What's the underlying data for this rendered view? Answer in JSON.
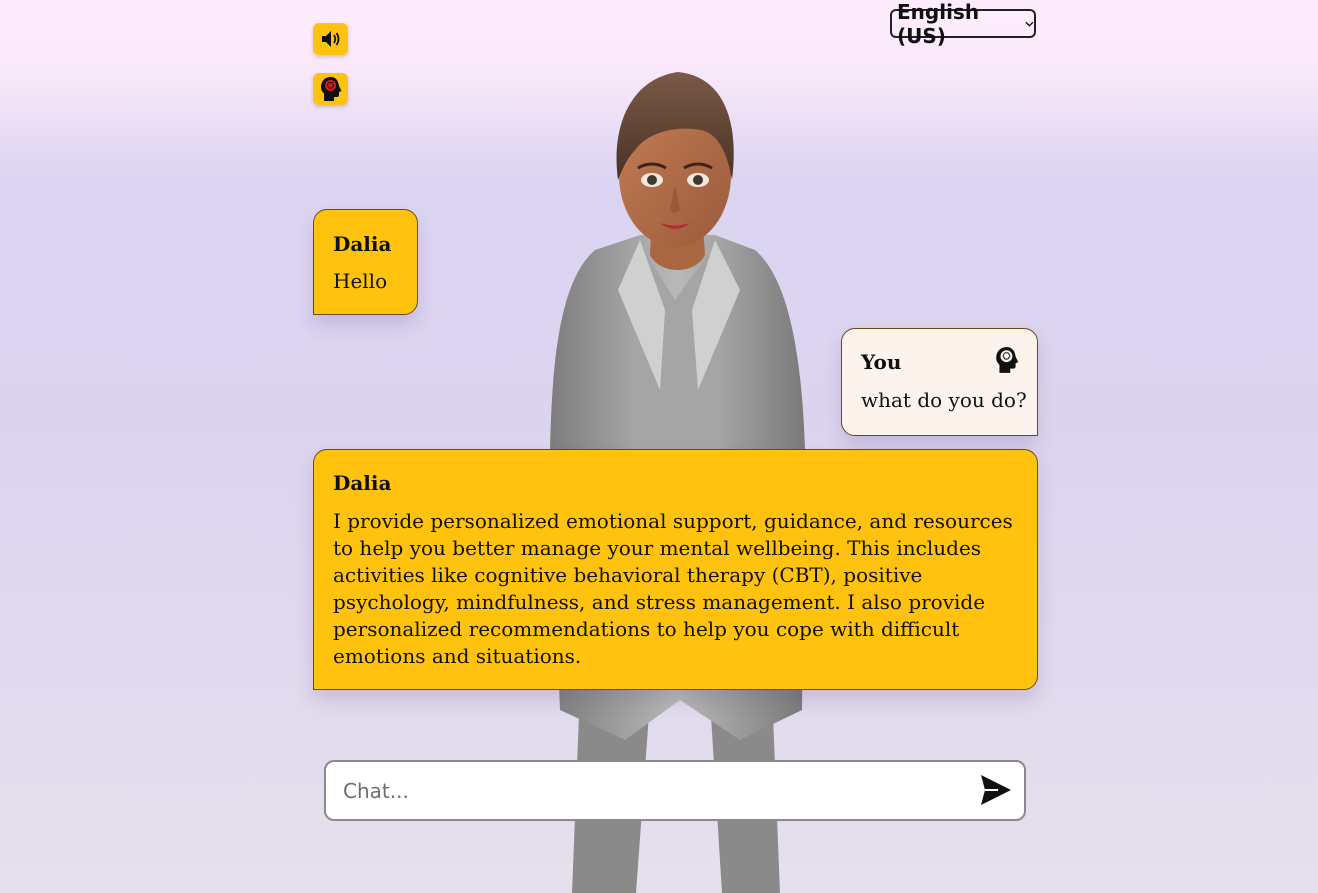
{
  "language": {
    "selected": "English (US)"
  },
  "toolbar": {
    "sound_icon": "speaker-icon",
    "mind_icon": "head-brain-icon"
  },
  "messages": [
    {
      "sender": "Dalia",
      "text": "Hello"
    },
    {
      "sender": "You",
      "text": "what do you do?",
      "icon": "head-brain-icon"
    },
    {
      "sender": "Dalia",
      "text": "I provide personalized emotional support, guidance, and resources to help you better manage your mental wellbeing. This includes activities like cognitive behavioral therapy (CBT), positive psychology, mindfulness, and stress management. I also provide personalized recommendations to help you cope with difficult emotions and situations."
    }
  ],
  "chat": {
    "placeholder": "Chat...",
    "value": "",
    "send_icon": "send-icon"
  },
  "colors": {
    "bubble_bot": "#ffc30f",
    "bubble_user": "#fbf3ec",
    "button": "#ffc20e"
  }
}
